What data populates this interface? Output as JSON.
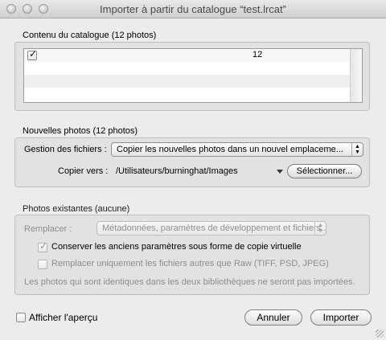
{
  "window": {
    "title": "Importer à partir du catalogue “test.lrcat”"
  },
  "catalog": {
    "heading": "Contenu du catalogue (12 photos)",
    "rows": [
      {
        "checked": true,
        "count": "12"
      }
    ]
  },
  "new_photos": {
    "heading": "Nouvelles photos (12 photos)",
    "file_handling_label": "Gestion des fichiers :",
    "file_handling_value": "Copier les nouvelles photos dans un nouvel emplaceme...",
    "copy_to_label": "Copier vers :",
    "copy_to_path": "/Utilisateurs/burninghat/Images",
    "select_button": "Sélectionner..."
  },
  "existing_photos": {
    "heading": "Photos existantes (aucune)",
    "replace_label": "Remplacer :",
    "replace_value": "Métadonnées, paramètres de développement et fichiers...",
    "keep_old_label": "Conserver les anciens paramètres sous forme de copie virtuelle",
    "keep_old_checked": true,
    "replace_non_raw_label": "Remplacer uniquement les fichiers autres que Raw (TIFF, PSD, JPEG)",
    "replace_non_raw_checked": false,
    "note": "Les photos qui sont identiques dans les deux bibliothèques ne seront pas importées."
  },
  "footer": {
    "preview_label": "Afficher l'aperçu",
    "preview_checked": false,
    "cancel_button": "Annuler",
    "import_button": "Importer"
  }
}
